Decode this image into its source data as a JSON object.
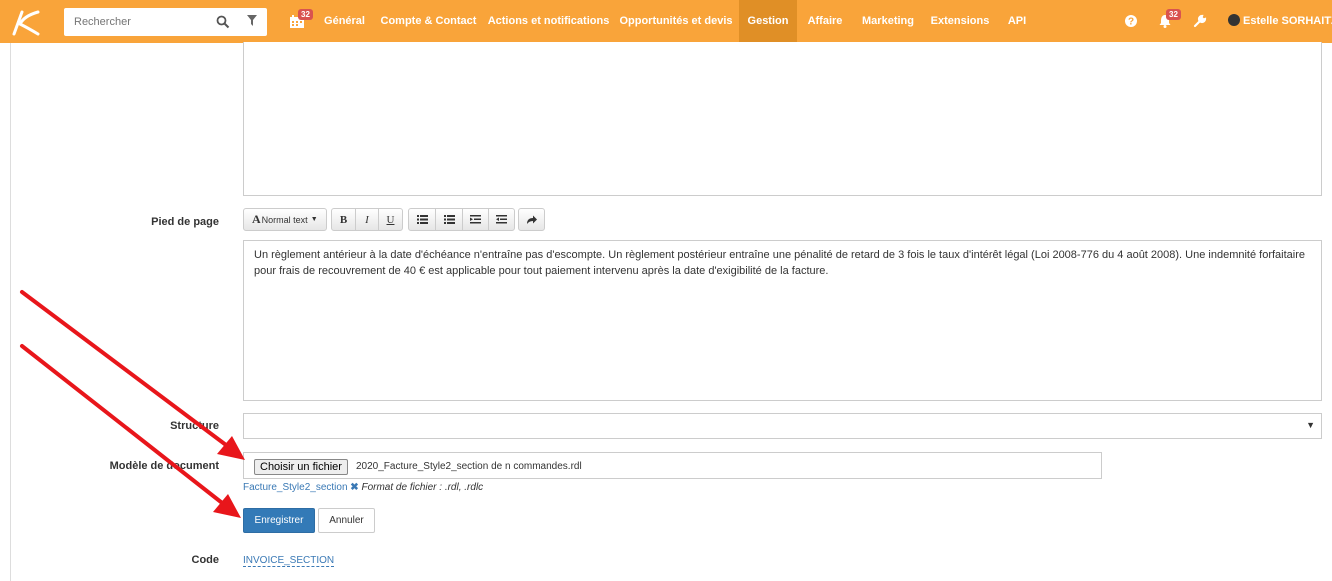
{
  "topbar": {
    "search_placeholder": "Rechercher",
    "calendar_badge": "32",
    "nav": [
      "Général",
      "Compte & Contact",
      "Actions et notifications",
      "Opportunités et devis",
      "Gestion",
      "Affaire",
      "Marketing",
      "Extensions",
      "API"
    ],
    "active_nav": "Gestion",
    "notif_badge": "32",
    "user_name": "Estelle SORHAITZ"
  },
  "form": {
    "footer_label": "Pied de page",
    "toolbar_style": "Normal text",
    "footer_text": "Un règlement antérieur à la date d'échéance n'entraîne pas d'escompte. Un règlement postérieur entraîne une pénalité de retard de 3 fois le taux d'intérêt légal (Loi 2008-776 du 4 août 2008). Une indemnité forfaitaire pour frais de recouvrement de 40 € est applicable pour tout paiement intervenu après la date d'exigibilité de la facture.",
    "structure_label": "Structure",
    "structure_value": "",
    "doc_model_label": "Modèle de document",
    "choose_file": "Choisir un fichier",
    "file_name": "2020_Facture_Style2_section de n commandes.rdl",
    "current_file": "Facture_Style2_section",
    "format_hint": "Format de fichier : .rdl, .rdlc",
    "save": "Enregistrer",
    "cancel": "Annuler",
    "code_label": "Code",
    "code_value": "INVOICE_SECTION"
  },
  "colors": {
    "topbar": "#f9a43a",
    "active": "#e08f26",
    "primary": "#337ab7",
    "arrow": "#e8161b",
    "link": "#3a79b5"
  }
}
